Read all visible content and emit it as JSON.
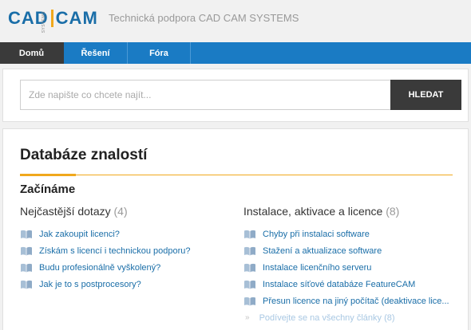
{
  "header": {
    "logo_left": "CAD",
    "logo_right": "CAM",
    "logo_small": "SYSTEMS",
    "site_title": "Technická podpora CAD CAM SYSTEMS"
  },
  "nav": {
    "items": [
      {
        "label": "Domů",
        "active": true
      },
      {
        "label": "Řešení",
        "active": false
      },
      {
        "label": "Fóra",
        "active": false
      }
    ]
  },
  "search": {
    "placeholder": "Zde napište co chcete najít...",
    "value": "",
    "button_label": "HLEDAT"
  },
  "main": {
    "title": "Databáze znalostí",
    "section_title": "Začínáme",
    "columns": [
      {
        "heading": "Nejčastější dotazy",
        "count": "(4)",
        "articles": [
          "Jak zakoupit licenci?",
          "Získám s licencí i technickou podporu?",
          "Budu profesionálně vyškolený?",
          "Jak je to s postprocesory?"
        ]
      },
      {
        "heading": "Instalace, aktivace a licence",
        "count": "(8)",
        "articles": [
          "Chyby při instalaci software",
          "Stažení a aktualizace software",
          "Instalace licenčního serveru",
          "Instalace síťové databáze FeatureCAM",
          "Přesun licence na jiný počítač (deaktivace lice..."
        ],
        "see_all": "Podívejte se na všechny články (8)"
      }
    ]
  },
  "colors": {
    "brand_blue": "#1a7bc4",
    "accent_orange": "#f0a81c",
    "dark": "#3a3a3a",
    "link": "#1a6ea8"
  },
  "icons": {
    "article": "book-icon",
    "see_all": "double-chevron-right-icon"
  }
}
